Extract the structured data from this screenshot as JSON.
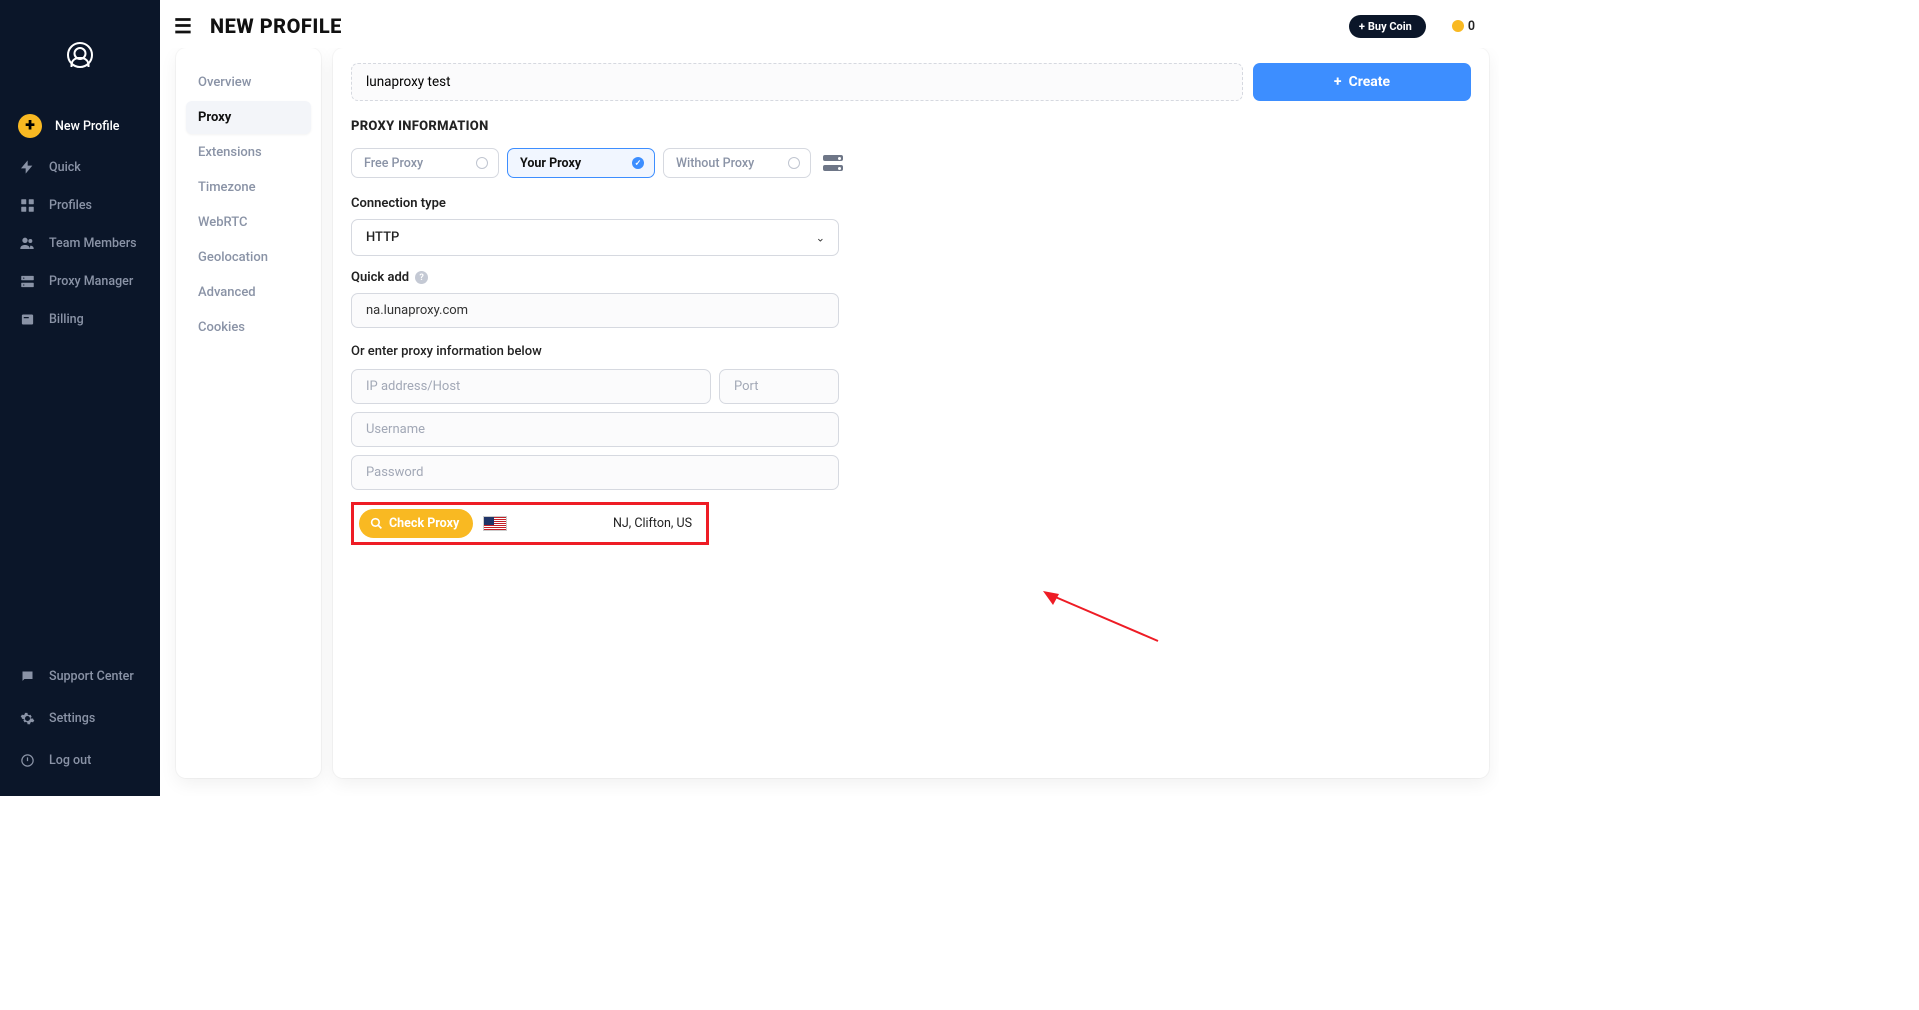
{
  "header": {
    "title": "NEW PROFILE",
    "buy_coin": "Buy Coin",
    "coin_count": "0"
  },
  "sidebar": {
    "items": [
      {
        "label": "New Profile"
      },
      {
        "label": "Quick"
      },
      {
        "label": "Profiles"
      },
      {
        "label": "Team Members"
      },
      {
        "label": "Proxy Manager"
      },
      {
        "label": "Billing"
      }
    ],
    "bottom": [
      {
        "label": "Support Center"
      },
      {
        "label": "Settings"
      },
      {
        "label": "Log out"
      }
    ]
  },
  "tabs": [
    {
      "label": "Overview"
    },
    {
      "label": "Proxy"
    },
    {
      "label": "Extensions"
    },
    {
      "label": "Timezone"
    },
    {
      "label": "WebRTC"
    },
    {
      "label": "Geolocation"
    },
    {
      "label": "Advanced"
    },
    {
      "label": "Cookies"
    }
  ],
  "form": {
    "profile_name": "lunaproxy test",
    "create_label": "Create",
    "section_title": "PROXY INFORMATION",
    "proxy_types": {
      "free": "Free Proxy",
      "your": "Your Proxy",
      "without": "Without Proxy"
    },
    "connection_label": "Connection type",
    "connection_value": "HTTP",
    "quick_add_label": "Quick add",
    "quick_add_value": "na.lunaproxy.com",
    "or_text": "Or enter proxy information below",
    "placeholders": {
      "host": "IP address/Host",
      "port": "Port",
      "username": "Username",
      "password": "Password"
    },
    "check_proxy_label": "Check Proxy",
    "location_result": "NJ, Clifton, US"
  }
}
